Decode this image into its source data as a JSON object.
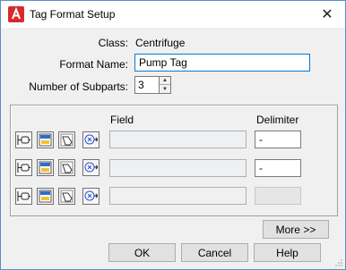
{
  "window": {
    "title": "Tag Format Setup"
  },
  "form": {
    "class_label": "Class:",
    "class_value": "Centrifuge",
    "format_name_label": "Format Name:",
    "format_name_value": "Pump Tag",
    "subparts_label": "Number of Subparts:",
    "subparts_value": "3"
  },
  "subparts": {
    "field_header": "Field",
    "delimiter_header": "Delimiter",
    "rows": [
      {
        "field": "",
        "delimiter": "-",
        "delimiter_enabled": true
      },
      {
        "field": "",
        "delimiter": "-",
        "delimiter_enabled": true
      },
      {
        "field": "",
        "delimiter": "",
        "delimiter_enabled": false
      }
    ],
    "row_icons": [
      "select-class-icon",
      "select-property-icon",
      "edit-tool-icon",
      "expression-icon"
    ]
  },
  "buttons": {
    "more": "More >>",
    "ok": "OK",
    "cancel": "Cancel",
    "help": "Help"
  },
  "colors": {
    "accent": "#0078d7",
    "app_icon_red": "#d62b2b"
  }
}
